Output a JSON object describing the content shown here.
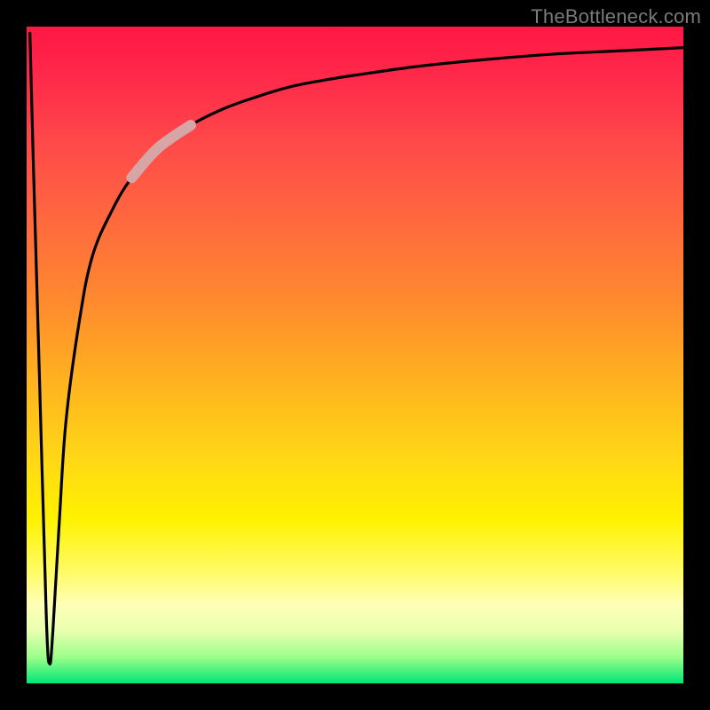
{
  "watermark": "TheBottleneck.com",
  "chart_data": {
    "type": "line",
    "title": "",
    "xlabel": "",
    "ylabel": "",
    "xlim": [
      0,
      100
    ],
    "ylim": [
      0,
      100
    ],
    "series": [
      {
        "name": "bottleneck-curve",
        "x": [
          0.5,
          1.0,
          2.0,
          3.0,
          3.5,
          4.0,
          5.0,
          6.0,
          8.0,
          10.0,
          13.0,
          16.0,
          20.0,
          25.0,
          30.0,
          35.0,
          40.0,
          45.0,
          50.0,
          60.0,
          70.0,
          80.0,
          90.0,
          100.0
        ],
        "y": [
          99.0,
          80.0,
          45.0,
          10.0,
          3.0,
          8.0,
          25.0,
          40.0,
          55.0,
          65.0,
          72.0,
          77.0,
          81.5,
          85.0,
          87.5,
          89.3,
          90.8,
          91.8,
          92.6,
          94.0,
          95.0,
          95.8,
          96.3,
          96.8
        ]
      }
    ],
    "highlight_segment": {
      "x_start": 16.0,
      "x_end": 25.0
    },
    "background_gradient": {
      "top_color": "#ff1744",
      "mid_color": "#fff200",
      "bottom_color": "#00e676"
    }
  }
}
